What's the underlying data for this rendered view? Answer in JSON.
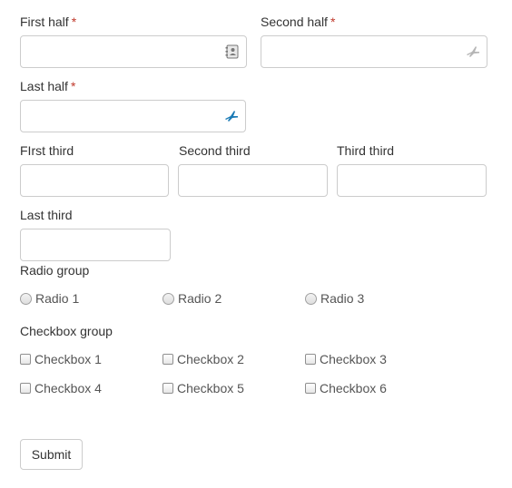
{
  "fields": {
    "first_half": {
      "label": "First half",
      "required_mark": "*",
      "value": "",
      "icon": "contact-book-icon"
    },
    "second_half": {
      "label": "Second half",
      "required_mark": "*",
      "value": "",
      "icon": "plane-icon"
    },
    "last_half": {
      "label": "Last half",
      "required_mark": "*",
      "value": "",
      "icon": "plane-active-icon"
    },
    "first_third": {
      "label": "FIrst third",
      "value": ""
    },
    "second_third": {
      "label": "Second third",
      "value": ""
    },
    "third_third": {
      "label": "Third third",
      "value": ""
    },
    "last_third": {
      "label": "Last third",
      "value": ""
    }
  },
  "radio_group": {
    "label": "Radio group",
    "options": [
      "Radio 1",
      "Radio 2",
      "Radio 3"
    ]
  },
  "checkbox_group": {
    "label": "Checkbox group",
    "options": [
      "Checkbox 1",
      "Checkbox 2",
      "Checkbox 3",
      "Checkbox 4",
      "Checkbox 5",
      "Checkbox 6"
    ]
  },
  "submit_label": "Submit",
  "colors": {
    "required": "#c0392b",
    "border": "#cccccc",
    "accent_icon": "#1a7ab5"
  }
}
